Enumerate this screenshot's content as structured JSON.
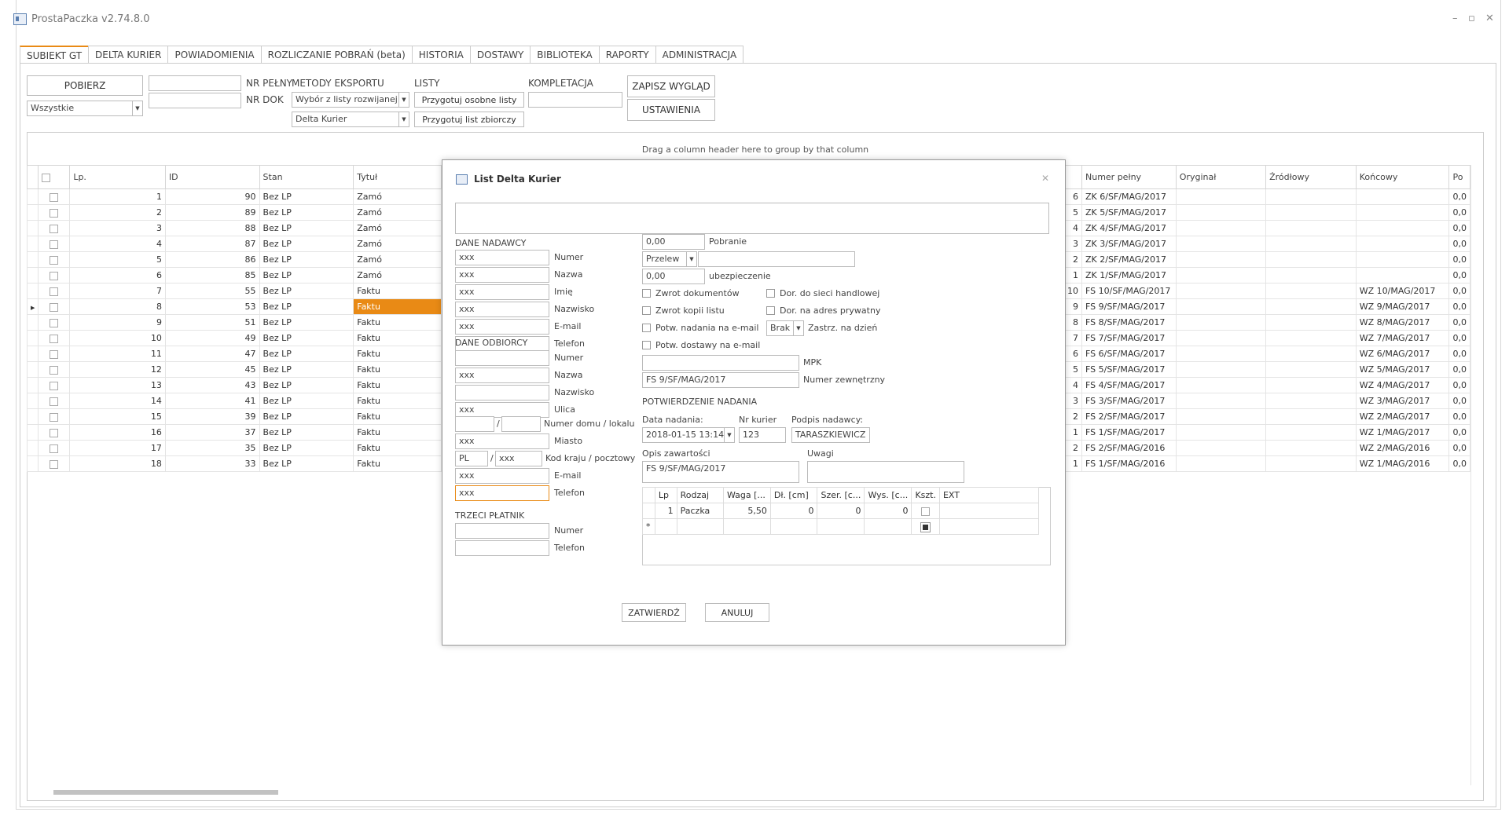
{
  "app": {
    "title": "ProstaPaczka v2.74.8.0"
  },
  "tabs": [
    "SUBIEKT GT",
    "DELTA KURIER",
    "POWIADOMIENIA",
    "ROZLICZANIE POBRAŃ (beta)",
    "HISTORIA",
    "DOSTAWY",
    "BIBLIOTEKA",
    "RAPORTY",
    "ADMINISTRACJA"
  ],
  "toolbar": {
    "pobierz": "POBIERZ",
    "filter_value": "Wszystkie",
    "nr_pelny": "NR PEŁNY",
    "nr_dok": "NR DOK",
    "metody_label": "METODY EKSPORTU",
    "metody_value": "Wybór z listy rozwijanej",
    "kurier_value": "Delta Kurier",
    "listy_label": "LISTY",
    "osobne": "Przygotuj osobne listy",
    "zbiorczy": "Przygotuj list zbiorczy",
    "kompletacja": "KOMPLETACJA",
    "zapisz": "ZAPISZ WYGLĄD",
    "ustawienia": "USTAWIENIA"
  },
  "grid": {
    "group_hint": "Drag a column header here to group by that column",
    "left_headers": [
      "Lp.",
      "ID",
      "Stan",
      "Tytuł"
    ],
    "right_headers": [
      "Numer pełny",
      "Oryginał",
      "Źródłowy",
      "Końcowy",
      "Po"
    ],
    "rows": [
      {
        "lp": "1",
        "id": "90",
        "stan": "Bez LP",
        "tytul": "Zamó",
        "nr": "6",
        "numer": "ZK 6/SF/MAG/2017",
        "koncowy": "",
        "po": "0,0"
      },
      {
        "lp": "2",
        "id": "89",
        "stan": "Bez LP",
        "tytul": "Zamó",
        "nr": "5",
        "numer": "ZK 5/SF/MAG/2017",
        "koncowy": "",
        "po": "0,0"
      },
      {
        "lp": "3",
        "id": "88",
        "stan": "Bez LP",
        "tytul": "Zamó",
        "nr": "4",
        "numer": "ZK 4/SF/MAG/2017",
        "koncowy": "",
        "po": "0,0"
      },
      {
        "lp": "4",
        "id": "87",
        "stan": "Bez LP",
        "tytul": "Zamó",
        "nr": "3",
        "numer": "ZK 3/SF/MAG/2017",
        "koncowy": "",
        "po": "0,0"
      },
      {
        "lp": "5",
        "id": "86",
        "stan": "Bez LP",
        "tytul": "Zamó",
        "nr": "2",
        "numer": "ZK 2/SF/MAG/2017",
        "koncowy": "",
        "po": "0,0"
      },
      {
        "lp": "6",
        "id": "85",
        "stan": "Bez LP",
        "tytul": "Zamó",
        "nr": "1",
        "numer": "ZK 1/SF/MAG/2017",
        "koncowy": "",
        "po": "0,0"
      },
      {
        "lp": "7",
        "id": "55",
        "stan": "Bez LP",
        "tytul": "Faktu",
        "nr": "10",
        "numer": "FS 10/SF/MAG/2017",
        "koncowy": "WZ 10/MAG/2017",
        "po": "0,0"
      },
      {
        "lp": "8",
        "id": "53",
        "stan": "Bez LP",
        "tytul": "Faktu",
        "nr": "9",
        "numer": "FS 9/SF/MAG/2017",
        "koncowy": "WZ 9/MAG/2017",
        "po": "0,0"
      },
      {
        "lp": "9",
        "id": "51",
        "stan": "Bez LP",
        "tytul": "Faktu",
        "nr": "8",
        "numer": "FS 8/SF/MAG/2017",
        "koncowy": "WZ 8/MAG/2017",
        "po": "0,0"
      },
      {
        "lp": "10",
        "id": "49",
        "stan": "Bez LP",
        "tytul": "Faktu",
        "nr": "7",
        "numer": "FS 7/SF/MAG/2017",
        "koncowy": "WZ 7/MAG/2017",
        "po": "0,0"
      },
      {
        "lp": "11",
        "id": "47",
        "stan": "Bez LP",
        "tytul": "Faktu",
        "nr": "6",
        "numer": "FS 6/SF/MAG/2017",
        "koncowy": "WZ 6/MAG/2017",
        "po": "0,0"
      },
      {
        "lp": "12",
        "id": "45",
        "stan": "Bez LP",
        "tytul": "Faktu",
        "nr": "5",
        "numer": "FS 5/SF/MAG/2017",
        "koncowy": "WZ 5/MAG/2017",
        "po": "0,0"
      },
      {
        "lp": "13",
        "id": "43",
        "stan": "Bez LP",
        "tytul": "Faktu",
        "nr": "4",
        "numer": "FS 4/SF/MAG/2017",
        "koncowy": "WZ 4/MAG/2017",
        "po": "0,0"
      },
      {
        "lp": "14",
        "id": "41",
        "stan": "Bez LP",
        "tytul": "Faktu",
        "nr": "3",
        "numer": "FS 3/SF/MAG/2017",
        "koncowy": "WZ 3/MAG/2017",
        "po": "0,0"
      },
      {
        "lp": "15",
        "id": "39",
        "stan": "Bez LP",
        "tytul": "Faktu",
        "nr": "2",
        "numer": "FS 2/SF/MAG/2017",
        "koncowy": "WZ 2/MAG/2017",
        "po": "0,0"
      },
      {
        "lp": "16",
        "id": "37",
        "stan": "Bez LP",
        "tytul": "Faktu",
        "nr": "1",
        "numer": "FS 1/SF/MAG/2017",
        "koncowy": "WZ 1/MAG/2017",
        "po": "0,0"
      },
      {
        "lp": "17",
        "id": "35",
        "stan": "Bez LP",
        "tytul": "Faktu",
        "nr": "2",
        "numer": "FS 2/SF/MAG/2016",
        "koncowy": "WZ 2/MAG/2016",
        "po": "0,0"
      },
      {
        "lp": "18",
        "id": "33",
        "stan": "Bez LP",
        "tytul": "Faktu",
        "nr": "1",
        "numer": "FS 1/SF/MAG/2016",
        "koncowy": "WZ 1/MAG/2016",
        "po": "0,0"
      }
    ]
  },
  "dialog": {
    "title": "List Delta Kurier",
    "dane_nadawcy": "DANE NADAWCY",
    "nadawca_fields": [
      {
        "label": "Numer",
        "value": "xxx"
      },
      {
        "label": "Nazwa",
        "value": "xxx"
      },
      {
        "label": "Imię",
        "value": "xxx"
      },
      {
        "label": "Nazwisko",
        "value": "xxx"
      },
      {
        "label": "E-mail",
        "value": "xxx"
      },
      {
        "label": "Telefon",
        "value": ""
      }
    ],
    "dane_odbiorcy": "DANE ODBIORCY",
    "odbiorca_fields": [
      {
        "label": "Numer",
        "value": ""
      },
      {
        "label": "Nazwa",
        "value": "xxx"
      },
      {
        "label": "Nazwisko",
        "value": ""
      },
      {
        "label": "Ulica",
        "value": "xxx"
      }
    ],
    "numer_domu_label": "Numer domu / lokalu",
    "slash": "/",
    "miasto_label": "Miasto",
    "miasto_value": "xxx",
    "kod_label": "Kod kraju / pocztowy",
    "kraj_value": "PL",
    "kod_value": "xxx",
    "email_label": "E-mail",
    "email_value": "xxx",
    "telefon_label": "Telefon",
    "telefon_value": "xxx",
    "trzeci": "TRZECI PŁATNIK",
    "trzeci_numer": "Numer",
    "trzeci_telefon": "Telefon",
    "pobranie_value": "0,00",
    "pobranie_label": "Pobranie",
    "przelew_value": "Przelew",
    "ubezp_value": "0,00",
    "ubezp_label": "ubezpieczenie",
    "zwrot_dok": "Zwrot dokumentów",
    "dor_sieci": "Dor. do sieci handlowej",
    "zwrot_kopii": "Zwrot kopii listu",
    "dor_adres": "Dor. na adres prywatny",
    "potw_nadania": "Potw. nadania na e-mail",
    "brak_value": "Brak",
    "zastrz": "Zastrz. na dzień",
    "potw_dostawy": "Potw. dostawy na e-mail",
    "mpk_label": "MPK",
    "numer_zew_value": "FS 9/SF/MAG/2017",
    "numer_zew_label": "Numer zewnętrzny",
    "potw_header": "POTWIERDZENIE NADANIA",
    "data_label": "Data nadania:",
    "data_value": "2018-01-15 13:14",
    "nr_kurier_label": "Nr kurier",
    "nr_kurier_value": "123",
    "podpis_label": "Podpis nadawcy:",
    "podpis_value": "TARASZKIEWICZ",
    "opis_label": "Opis zawartości",
    "opis_value": "FS 9/SF/MAG/2017",
    "uwagi_label": "Uwagi",
    "packages": {
      "headers": [
        "Lp",
        "Rodzaj",
        "Waga [...",
        "Dł. [cm]",
        "Szer. [c...",
        "Wys. [c...",
        "Kszt.",
        "EXT"
      ],
      "row": {
        "lp": "1",
        "rodzaj": "Paczka",
        "waga": "5,50",
        "dl": "0",
        "szer": "0",
        "wys": "0"
      },
      "new_row_marker": "*"
    },
    "zatwierdz": "ZATWIERDŹ",
    "anuluj": "ANULUJ"
  }
}
